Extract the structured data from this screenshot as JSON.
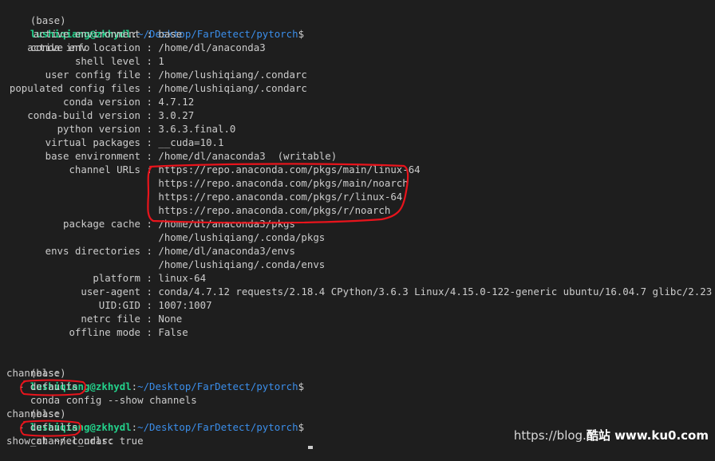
{
  "prompt": {
    "env": "(base)",
    "user_host": "lushiqiang@zkhydl",
    "colon": ":",
    "cwd": "~/Desktop/FarDetect/pytorch",
    "suffix": "$"
  },
  "commands": {
    "first": "conda info",
    "second": "conda config --show channels",
    "third": "cat ~/.condarc"
  },
  "info": [
    {
      "key": "active environment",
      "values": [
        "base"
      ]
    },
    {
      "key": "active env location",
      "values": [
        "/home/dl/anaconda3"
      ]
    },
    {
      "key": "shell level",
      "values": [
        "1"
      ]
    },
    {
      "key": "user config file",
      "values": [
        "/home/lushiqiang/.condarc"
      ]
    },
    {
      "key": "populated config files",
      "values": [
        "/home/lushiqiang/.condarc"
      ]
    },
    {
      "key": "conda version",
      "values": [
        "4.7.12"
      ]
    },
    {
      "key": "conda-build version",
      "values": [
        "3.0.27"
      ]
    },
    {
      "key": "python version",
      "values": [
        "3.6.3.final.0"
      ]
    },
    {
      "key": "virtual packages",
      "values": [
        "__cuda=10.1"
      ]
    },
    {
      "key": "base environment",
      "values": [
        "/home/dl/anaconda3  (writable)"
      ]
    },
    {
      "key": "channel URLs",
      "values": [
        "https://repo.anaconda.com/pkgs/main/linux-64",
        "https://repo.anaconda.com/pkgs/main/noarch",
        "https://repo.anaconda.com/pkgs/r/linux-64",
        "https://repo.anaconda.com/pkgs/r/noarch"
      ]
    },
    {
      "key": "package cache",
      "values": [
        "/home/dl/anaconda3/pkgs",
        "/home/lushiqiang/.conda/pkgs"
      ]
    },
    {
      "key": "envs directories",
      "values": [
        "/home/dl/anaconda3/envs",
        "/home/lushiqiang/.conda/envs"
      ]
    },
    {
      "key": "platform",
      "values": [
        "linux-64"
      ]
    },
    {
      "key": "user-agent",
      "values": [
        "conda/4.7.12 requests/2.18.4 CPython/3.6.3 Linux/4.15.0-122-generic ubuntu/16.04.7 glibc/2.23"
      ]
    },
    {
      "key": "UID:GID",
      "values": [
        "1007:1007"
      ]
    },
    {
      "key": "netrc file",
      "values": [
        "None"
      ]
    },
    {
      "key": "offline mode",
      "values": [
        "False"
      ]
    }
  ],
  "output2": [
    "channels:",
    "  - defaults"
  ],
  "output3": [
    "channels:",
    "  - defaults",
    "show_channel_urls: true"
  ],
  "watermark": {
    "left": "https://blog.",
    "brand": "酷站 www.ku0.com"
  },
  "colors": {
    "annotation": "#e8141c",
    "user": "#23d18b",
    "path": "#3b8eea",
    "background": "#1e1e1e"
  }
}
